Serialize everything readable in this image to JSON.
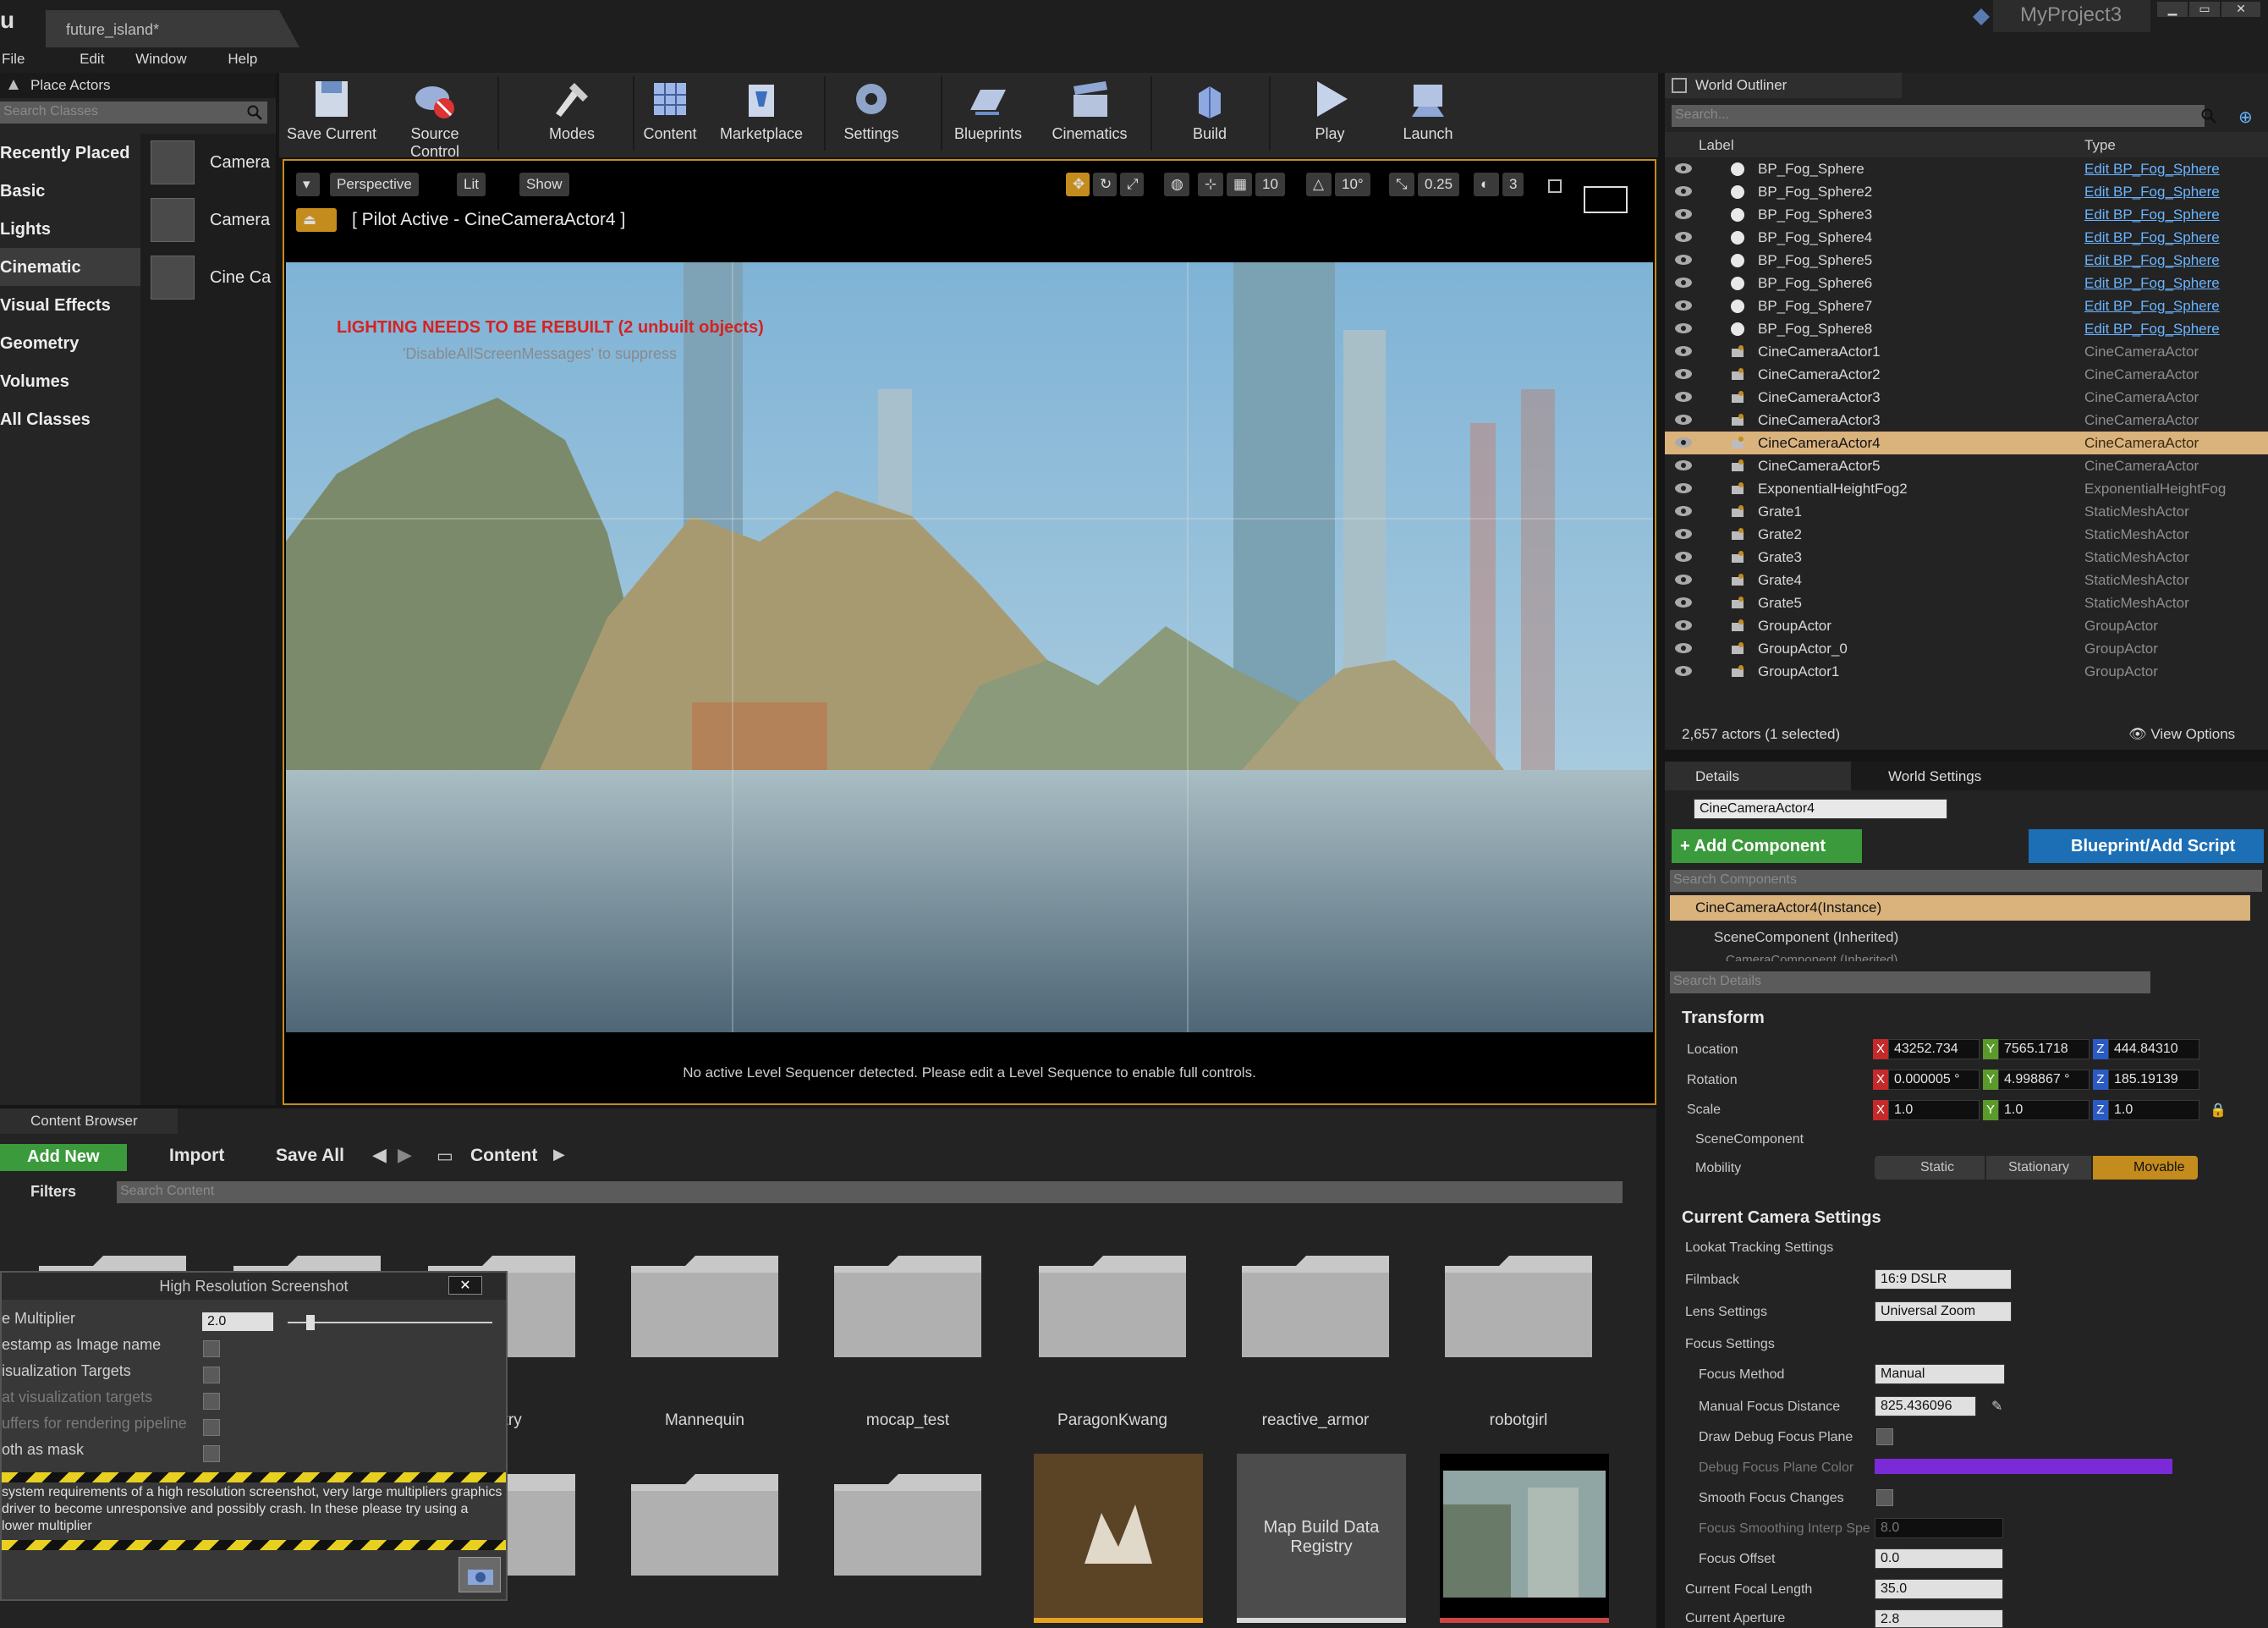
{
  "title_bar": {
    "tab": "future_island",
    "tab_modified": "*",
    "project": "MyProject3"
  },
  "menu": [
    "File",
    "Edit",
    "Window",
    "Help"
  ],
  "place_actors": {
    "title": "Place Actors",
    "search_placeholder": "Search Classes",
    "categories": [
      "Recently Placed",
      "Basic",
      "Lights",
      "Cinematic",
      "Visual Effects",
      "Geometry",
      "Volumes",
      "All Classes"
    ],
    "selected_category": "Cinematic",
    "items": [
      "Camera",
      "Camera",
      "Cine Ca"
    ]
  },
  "toolbar": [
    "Save Current",
    "Source Control",
    "Modes",
    "Content",
    "Marketplace",
    "Settings",
    "Blueprints",
    "Cinematics",
    "Build",
    "Play",
    "Launch"
  ],
  "viewport": {
    "perspective": "Perspective",
    "lit": "Lit",
    "show": "Show",
    "pilot": "[ Pilot Active - CineCameraActor4 ]",
    "grid_snap": "10",
    "rot_snap": "10°",
    "scale_snap": "0.25",
    "cam_speed": "3",
    "warning": "LIGHTING NEEDS TO BE REBUILT (2 unbuilt objects)",
    "warning_sub": "'DisableAllScreenMessages' to suppress",
    "footer": "No active Level Sequencer detected. Please edit a Level Sequence to enable full controls."
  },
  "outliner": {
    "title": "World Outliner",
    "search_placeholder": "Search...",
    "col_label": "Label",
    "col_type": "Type",
    "rows": [
      {
        "label": "BP_Fog_Sphere",
        "type": "Edit BP_Fog_Sphere",
        "link": true
      },
      {
        "label": "BP_Fog_Sphere2",
        "type": "Edit BP_Fog_Sphere",
        "link": true
      },
      {
        "label": "BP_Fog_Sphere3",
        "type": "Edit BP_Fog_Sphere",
        "link": true
      },
      {
        "label": "BP_Fog_Sphere4",
        "type": "Edit BP_Fog_Sphere",
        "link": true
      },
      {
        "label": "BP_Fog_Sphere5",
        "type": "Edit BP_Fog_Sphere",
        "link": true
      },
      {
        "label": "BP_Fog_Sphere6",
        "type": "Edit BP_Fog_Sphere",
        "link": true
      },
      {
        "label": "BP_Fog_Sphere7",
        "type": "Edit BP_Fog_Sphere",
        "link": true
      },
      {
        "label": "BP_Fog_Sphere8",
        "type": "Edit BP_Fog_Sphere",
        "link": true
      },
      {
        "label": "CineCameraActor1",
        "type": "CineCameraActor",
        "link": false
      },
      {
        "label": "CineCameraActor2",
        "type": "CineCameraActor",
        "link": false
      },
      {
        "label": "CineCameraActor3",
        "type": "CineCameraActor",
        "link": false
      },
      {
        "label": "CineCameraActor3",
        "type": "CineCameraActor",
        "link": false
      },
      {
        "label": "CineCameraActor4",
        "type": "CineCameraActor",
        "link": false,
        "selected": true
      },
      {
        "label": "CineCameraActor5",
        "type": "CineCameraActor",
        "link": false
      },
      {
        "label": "ExponentialHeightFog2",
        "type": "ExponentialHeightFog",
        "link": false
      },
      {
        "label": "Grate1",
        "type": "StaticMeshActor",
        "link": false
      },
      {
        "label": "Grate2",
        "type": "StaticMeshActor",
        "link": false
      },
      {
        "label": "Grate3",
        "type": "StaticMeshActor",
        "link": false
      },
      {
        "label": "Grate4",
        "type": "StaticMeshActor",
        "link": false
      },
      {
        "label": "Grate5",
        "type": "StaticMeshActor",
        "link": false
      },
      {
        "label": "GroupActor",
        "type": "GroupActor",
        "link": false
      },
      {
        "label": "GroupActor_0",
        "type": "GroupActor",
        "link": false
      },
      {
        "label": "GroupActor1",
        "type": "GroupActor",
        "link": false
      }
    ],
    "count": "2,657 actors (1 selected)",
    "view_options": "View Options"
  },
  "details": {
    "tab_details": "Details",
    "tab_world": "World Settings",
    "name": "CineCameraActor4",
    "add_component": "+ Add Component",
    "blueprint": "Blueprint/Add Script",
    "search_components": "Search Components",
    "instance": "CineCameraActor4(Instance)",
    "scene_component": "SceneComponent (Inherited)",
    "camera_component": "CameraComponent (Inherited)",
    "search_details": "Search Details",
    "transform": "Transform",
    "location_label": "Location",
    "rotation_label": "Rotation",
    "scale_label": "Scale",
    "location": [
      "43252.734",
      "7565.1718",
      "444.84310"
    ],
    "rotation": [
      "0.000005 °",
      "4.998867 °",
      "185.19139"
    ],
    "scale": [
      "1.0",
      "1.0",
      "1.0"
    ],
    "scene_comp_section": "SceneComponent",
    "mobility_label": "Mobility",
    "mobility": [
      "Static",
      "Stationary",
      "Movable"
    ],
    "camera_section": "Current Camera Settings",
    "lookat": "Lookat Tracking Settings",
    "filmback": "Filmback",
    "filmback_value": "16:9 DSLR",
    "lens": "Lens Settings",
    "lens_value": "Universal Zoom",
    "focus": "Focus Settings",
    "focus_method": "Focus Method",
    "focus_method_value": "Manual",
    "manual_focus": "Manual Focus Distance",
    "manual_focus_value": "825.436096",
    "draw_debug": "Draw Debug Focus Plane",
    "debug_color": "Debug Focus Plane Color",
    "smooth_focus": "Smooth Focus Changes",
    "focus_smoothing": "Focus Smoothing Interp Spe",
    "focus_smoothing_value": "8.0",
    "focus_offset": "Focus Offset",
    "focus_offset_value": "0.0",
    "focal_length": "Current Focal Length",
    "focal_length_value": "35.0",
    "aperture": "Current Aperture",
    "aperture_value": "2.8"
  },
  "content_browser": {
    "title": "Content Browser",
    "add_new": "Add New",
    "import": "Import",
    "save_all": "Save All",
    "path": "Content",
    "filters": "Filters",
    "search_placeholder": "Search Content",
    "folders": [
      "metry",
      "Mannequin",
      "mocap_test",
      "ParagonKwang",
      "reactive_armor",
      "robotgirl"
    ],
    "asset_map": "Map Build Data Registry"
  },
  "screenshot_dialog": {
    "title": "High Resolution Screenshot",
    "rows": [
      "e Multiplier",
      "estamp as Image name",
      "isualization Targets",
      "at visualization targets",
      "uffers for rendering pipeline",
      "oth as mask"
    ],
    "multiplier": "2.0",
    "warning": "system requirements of a high resolution screenshot, very large multipliers graphics driver to become unresponsive and possibly crash. In these please try using a lower multiplier"
  },
  "colors": {
    "accent_orange": "#c48c1c",
    "selection": "#d9b27c",
    "link_blue": "#6ab4ff",
    "add_green": "#3b9a3b",
    "blueprint_blue": "#1d6fb5",
    "warning_red": "#d52222"
  }
}
